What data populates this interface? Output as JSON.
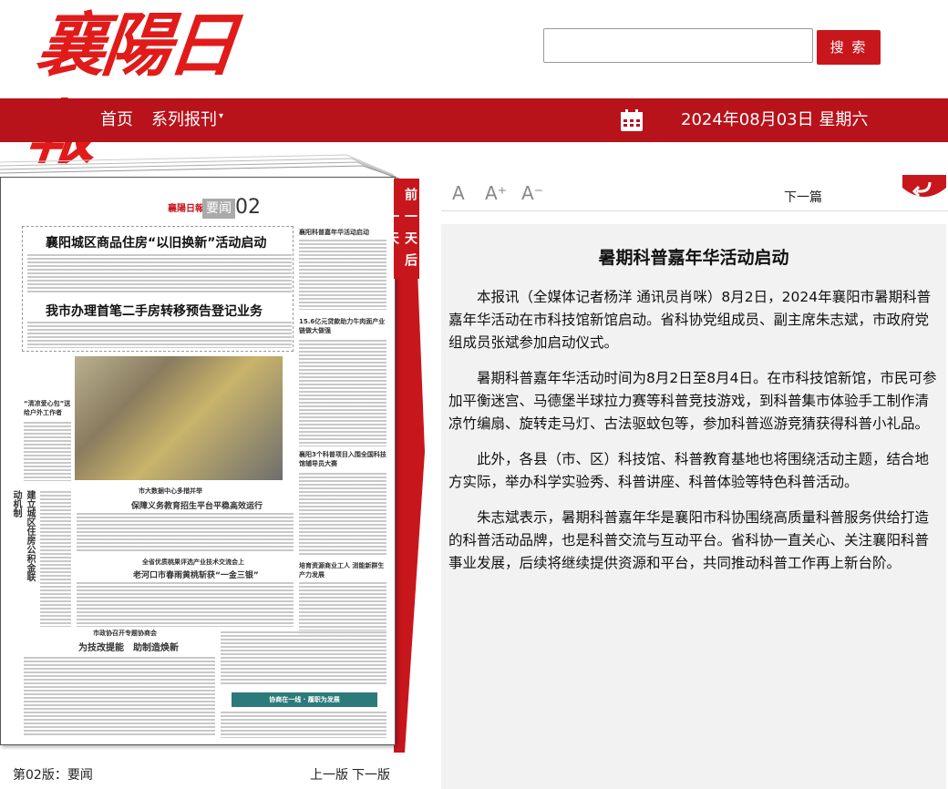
{
  "header": {
    "logo_text": "襄陽日報",
    "search_placeholder": "",
    "search_label": "搜 索"
  },
  "nav": {
    "home": "首页",
    "series": "系列报刊",
    "date": "2024年08月03日 星期六",
    "calendar_icon": "calendar-icon"
  },
  "colors": {
    "brand_red": "#c8161d",
    "nav_red": "#b8121b"
  },
  "paper": {
    "masthead": "襄陽日報",
    "section": "要闻",
    "page_number": "02",
    "headline_1": "襄阳城区商品住房“以旧换新”活动启动",
    "headline_2": "我市办理首笔二手房转移预告登记业务",
    "headline_3": "保障义务教育招生平台平稳高效运行",
    "headline_4": "老河口市春雨黄桃斩获“一金三银”",
    "headline_5": "为技改提能　助制造焕新",
    "side_head_1": "“清凉爱心包”送给户外工作者",
    "side_head_2": "建立城区住房公积金联动机制",
    "col_head_1": "襄阳科普嘉年华活动启动",
    "col_head_2": "15.6亿元贷款助力牛肉面产业链做大做强",
    "col_head_3": "襄阳3个科普项目入围全国科技馆辅导员大赛",
    "col_head_4": "培育资源商业工人 消能新群生产力发展",
    "sub_1": "市大数据中心多措并举",
    "sub_2": "全省优质桃果评选产业技术交流会上",
    "sub_3": "市政协召开专题协商会",
    "banner": "协商在一线 · 履职为发展"
  },
  "side_tab": {
    "label": "前一天后一天"
  },
  "footer": {
    "page_label": "第02版：要闻",
    "prev_page": "上一版",
    "next_page": "下一版"
  },
  "toolbar": {
    "font_normal": "A",
    "font_larger": "A⁺",
    "font_smaller": "A⁻",
    "next_article": "下一篇",
    "back_icon": "return-arrow-icon"
  },
  "article": {
    "title": "暑期科普嘉年华活动启动",
    "paragraphs": [
      "本报讯（全媒体记者杨洋 通讯员肖咪）8月2日，2024年襄阳市暑期科普嘉年华活动在市科技馆新馆启动。省科协党组成员、副主席朱志斌，市政府党组成员张斌参加启动仪式。",
      "暑期科普嘉年华活动时间为8月2日至8月4日。在市科技馆新馆，市民可参加平衡迷宫、马德堡半球拉力赛等科普竞技游戏，到科普集市体验手工制作清凉竹编扇、旋转走马灯、古法驱蚊包等，参加科普巡游竞猜获得科普小礼品。",
      "此外，各县（市、区）科技馆、科普教育基地也将围绕活动主题，结合地方实际，举办科学实验秀、科普讲座、科普体验等特色科普活动。",
      "朱志斌表示，暑期科普嘉年华是襄阳市科协围绕高质量科普服务供给打造的科普活动品牌，也是科普交流与互动平台。省科协一直关心、关注襄阳科普事业发展，后续将继续提供资源和平台，共同推动科普工作再上新台阶。"
    ]
  }
}
